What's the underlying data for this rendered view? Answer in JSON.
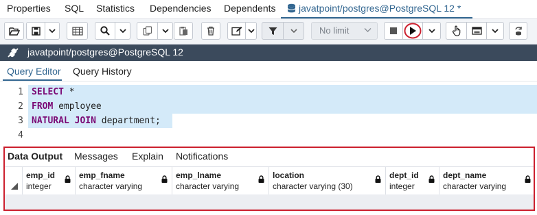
{
  "top_tabs": [
    {
      "label": "Properties",
      "active": false
    },
    {
      "label": "SQL",
      "active": false
    },
    {
      "label": "Statistics",
      "active": false
    },
    {
      "label": "Dependencies",
      "active": false
    },
    {
      "label": "Dependents",
      "active": false
    },
    {
      "label": "javatpoint/postgres@PostgreSQL 12 *",
      "active": true
    }
  ],
  "toolbar": {
    "limit_select": "No limit",
    "icons": [
      "open-folder-icon",
      "save-icon",
      "chevron-down-icon",
      "table-icon",
      "search-icon",
      "chevron-down-icon",
      "copy-icon",
      "chevron-down-icon",
      "paste-icon",
      "delete-icon",
      "edit-icon",
      "chevron-down-icon",
      "filter-icon",
      "chevron-down-icon",
      "stop-icon",
      "execute-icon",
      "chevron-down-icon",
      "hand-icon",
      "explain-icon",
      "chevron-down-icon",
      "commit-icon"
    ]
  },
  "connection": {
    "label": "javatpoint/postgres@PostgreSQL 12"
  },
  "query_tabs": [
    {
      "label": "Query Editor",
      "active": true
    },
    {
      "label": "Query History",
      "active": false
    }
  ],
  "editor": {
    "lines": [
      {
        "num": "1",
        "kw": "SELECT",
        "rest": " *"
      },
      {
        "num": "2",
        "kw": "FROM",
        "rest": " employee"
      },
      {
        "num": "3",
        "kw": "NATURAL JOIN",
        "rest": " department;"
      },
      {
        "num": "4",
        "kw": "",
        "rest": ""
      }
    ]
  },
  "output": {
    "tabs": [
      {
        "label": "Data Output",
        "active": true
      },
      {
        "label": "Messages",
        "active": false
      },
      {
        "label": "Explain",
        "active": false
      },
      {
        "label": "Notifications",
        "active": false
      }
    ],
    "columns": [
      {
        "name": "emp_id",
        "type": "integer"
      },
      {
        "name": "emp_fname",
        "type": "character varying"
      },
      {
        "name": "emp_lname",
        "type": "character varying"
      },
      {
        "name": "location",
        "type": "character varying (30)"
      },
      {
        "name": "dept_id",
        "type": "integer"
      },
      {
        "name": "dept_name",
        "type": "character varying"
      }
    ]
  },
  "colors": {
    "accent": "#326690",
    "conn_bar": "#3b4a5c",
    "highlight_border": "#cc1f2e",
    "execute_ring": "#cc1f2e"
  }
}
